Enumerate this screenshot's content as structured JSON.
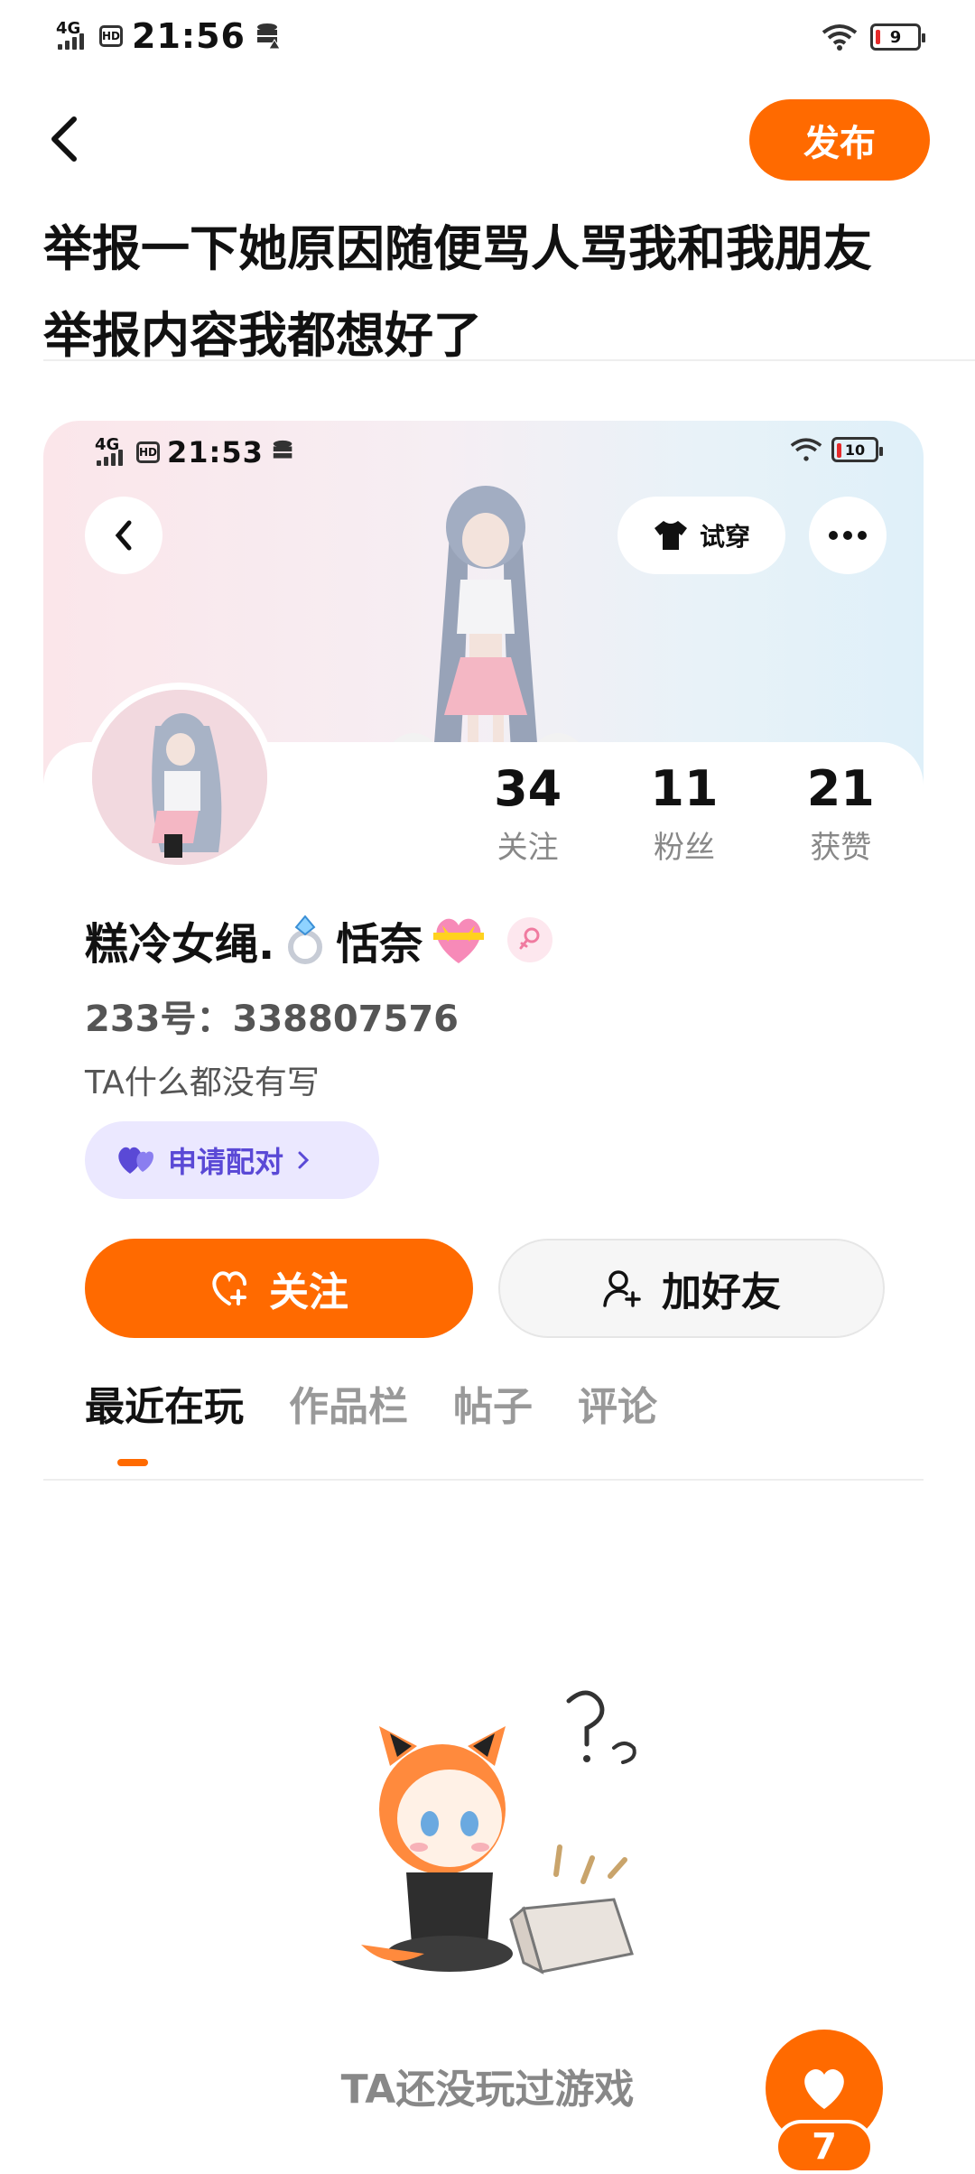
{
  "status_bar": {
    "network": "4G",
    "hd": "HD",
    "time": "21:56",
    "battery": "9"
  },
  "header": {
    "back_icon": "chevron-left-icon",
    "publish_label": "发布"
  },
  "post": {
    "title": "举报一下她原因随便骂人骂我和我朋友 举报内容我都想好了"
  },
  "embedded_screenshot": {
    "status_bar": {
      "network": "4G",
      "hd": "HD",
      "time": "21:53",
      "battery": "10"
    },
    "try_on_label": "试穿",
    "stats": [
      {
        "value": "34",
        "label": "关注"
      },
      {
        "value": "11",
        "label": "粉丝"
      },
      {
        "value": "21",
        "label": "获赞"
      }
    ],
    "profile": {
      "name_part1": "糕冷女绳.",
      "name_part2": "恬奈",
      "uid": "233号：338807576",
      "bio": "TA什么都没有写",
      "pair_label": "申请配对"
    },
    "buttons": {
      "follow": "关注",
      "add_friend": "加好友"
    },
    "tabs": [
      "最近在玩",
      "作品栏",
      "帖子",
      "评论"
    ],
    "empty_text": "TA还没玩过游戏"
  },
  "floating_like": {
    "count": "7"
  },
  "colors": {
    "accent": "#ff6a00",
    "pair_bg": "#ebe8ff",
    "pair_text": "#5a49d6"
  }
}
